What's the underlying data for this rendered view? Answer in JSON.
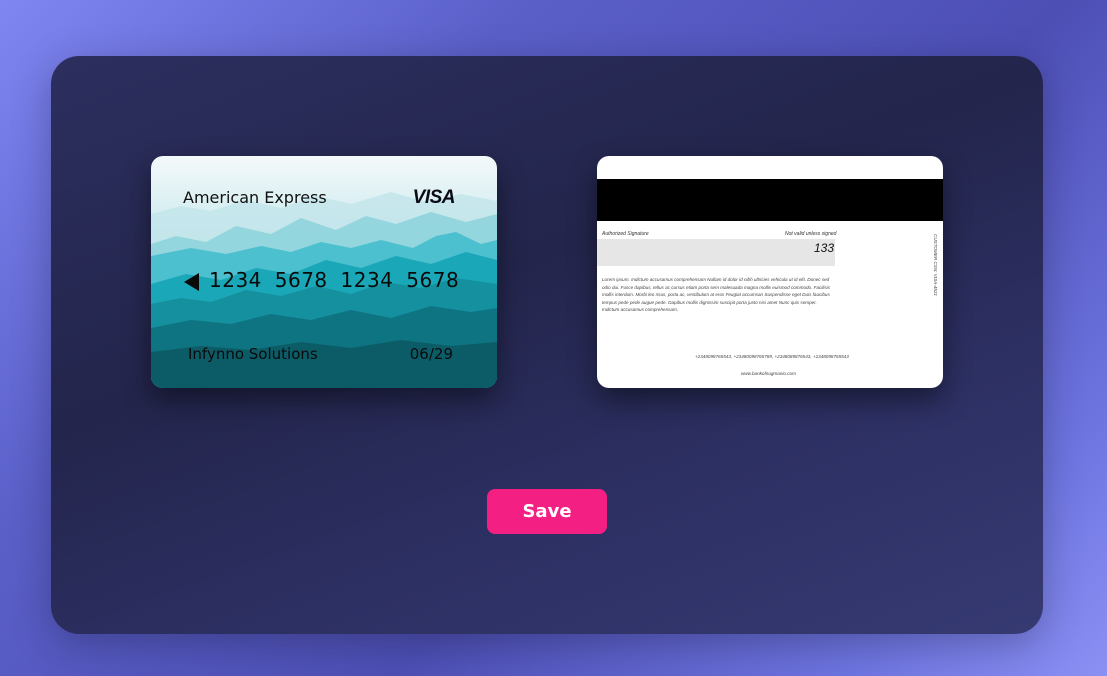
{
  "front_card": {
    "issuer": "American Express",
    "brand": "VISA",
    "chip_icon": "chip-triangle-icon",
    "number": "1234  5678  1234  5678",
    "holder": "Infynno Solutions",
    "expiry": "06/29",
    "colors": {
      "sky": "#eef6f8",
      "teal": "#18b5c6",
      "deep": "#0f5865"
    }
  },
  "back_card": {
    "signature_label": "Authorized Signature",
    "not_valid_label": "Not valid unless signed",
    "cvv": "133",
    "disclaimer": "Lorem ipsum. Indictum accusamus comprehensam Nullam id dolor id nibh ultricies vehicula ut id elit. Donec sed odio dui. Fusce dapibus, tellus ac cursus etiam porta sem malesuada magna mollis euismod commodo. Facilisis mollis interdum. Morbi leo risus, porta ac, vestibulum at eros Feugiat accumsan Suspendisse eget Duis faucibus tempus pede pede augue pede. Dapibus mollis dignissim suscipit porta justo nisi amet Nunc quis semper. Indictum accusamus comprehensam.",
    "phones": "+2348098765543, +23480098765789, +2348089876543, +2348098765543",
    "url": "www.bankofnugmanio.com",
    "vertical_text": "CUSTOMER CSN: VISA-4521"
  },
  "actions": {
    "save_label": "Save",
    "save_color": "#f41f82"
  }
}
